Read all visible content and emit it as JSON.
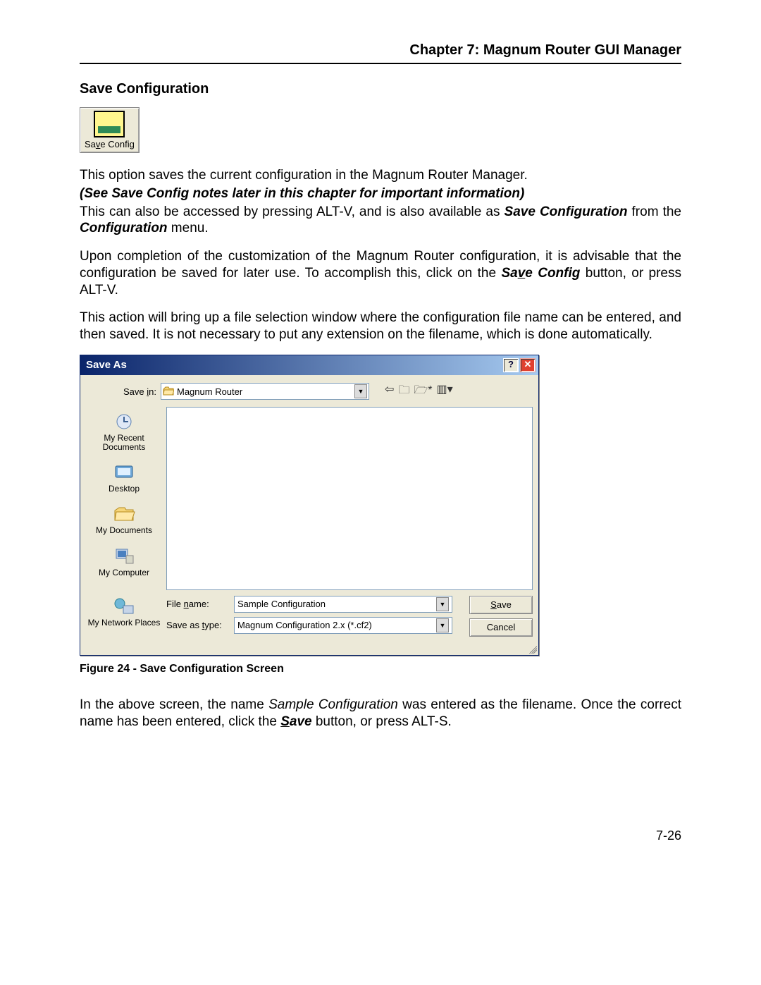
{
  "header": {
    "chapter_title": "Chapter 7: Magnum Router GUI Manager"
  },
  "section": {
    "title": "Save Configuration"
  },
  "save_config_button": {
    "pre": "Sa",
    "mnemonic": "v",
    "post": "e Config"
  },
  "paragraphs": {
    "p1": "This option saves the current configuration in the Magnum Router Manager.",
    "p2": "(See Save Config notes later in this chapter for important information)",
    "p3_a": "This can also be accessed by pressing ALT-V, and is also available as ",
    "p3_b": "Save Configuration",
    "p3_c": " from the ",
    "p3_d": "Configuration",
    "p3_e": " menu.",
    "p4_a": "Upon completion of the customization of the Magnum Router configuration, it is advisable that the configuration be saved for later use.  To accomplish this, click on the ",
    "p4_b_pre": "Sa",
    "p4_b_m": "v",
    "p4_b_post": "e Config",
    "p4_c": " button, or press ALT-V.",
    "p5": "This action will bring up a file selection window where the configuration file name can be entered, and then saved.  It is not necessary to put any extension on the filename, which is done automatically.",
    "p6_a": "In the above screen, the name ",
    "p6_b": "Sample Configuration",
    "p6_c": " was entered as the filename.  Once the correct name has been entered, click the ",
    "p6_d_pre": "",
    "p6_d_m": "S",
    "p6_d_post": "ave",
    "p6_e": " button, or press ALT-S."
  },
  "dialog": {
    "title": "Save As",
    "help": "?",
    "close": "✕",
    "save_in": {
      "pre": "Save ",
      "m": "i",
      "post": "n:"
    },
    "save_in_value": "Magnum Router",
    "toolbar": {
      "back": "⇦",
      "up": "🗀",
      "newfolder": "🗁*",
      "views": "▥▾"
    },
    "places": {
      "recent": "My Recent Documents",
      "desktop": "Desktop",
      "mydocs": "My Documents",
      "mycomp": "My Computer",
      "network": "My Network Places"
    },
    "file_name_label": {
      "pre": "File ",
      "m": "n",
      "post": "ame:"
    },
    "file_name_value": "Sample Configuration",
    "save_type_label": {
      "pre": "Save as ",
      "m": "t",
      "post": "ype:"
    },
    "save_type_value": "Magnum Configuration 2.x (*.cf2)",
    "save_btn": {
      "m": "S",
      "post": "ave"
    },
    "cancel_btn": "Cancel"
  },
  "figure_caption": "Figure 24 - Save Configuration Screen",
  "page_number": "7-26"
}
